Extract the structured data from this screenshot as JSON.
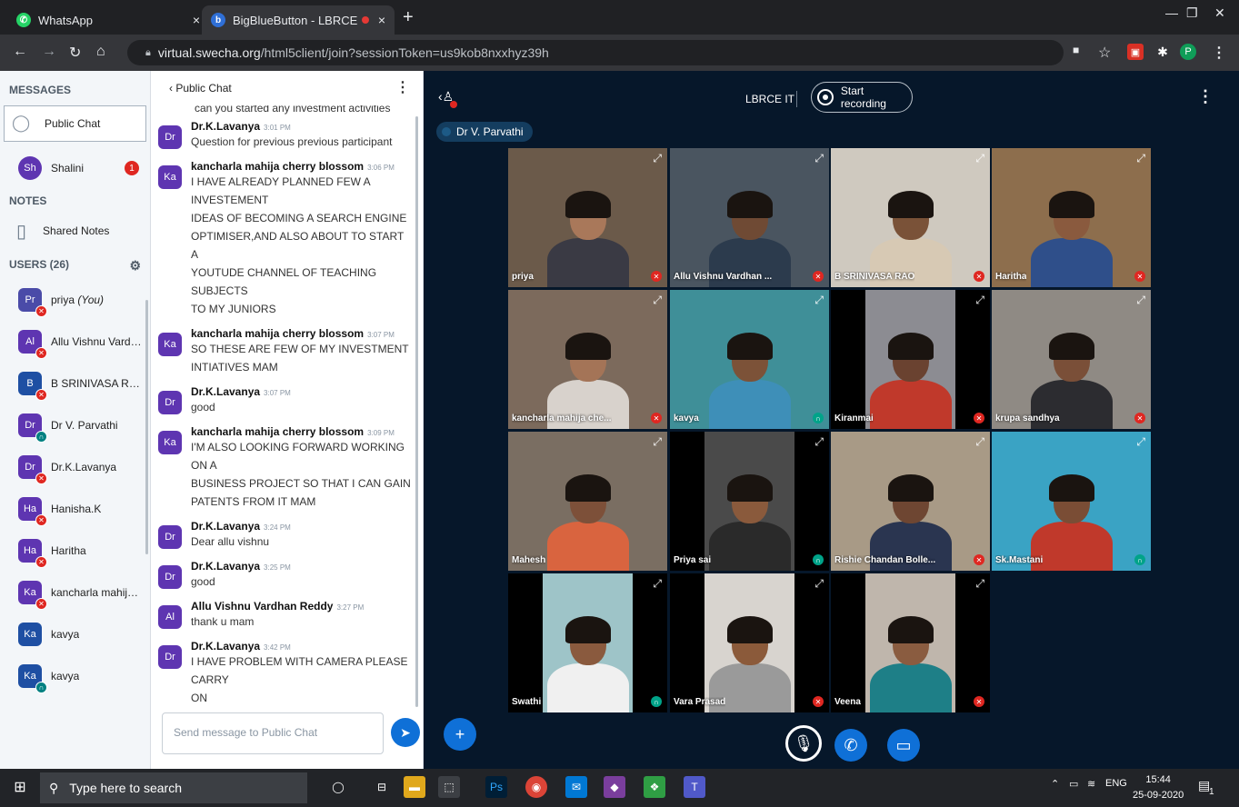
{
  "browser": {
    "tabs": [
      {
        "title": "WhatsApp",
        "close": "×"
      },
      {
        "title": "BigBlueButton - LBRCE IT",
        "close": "×"
      }
    ],
    "new_tab": "+",
    "url_host": "virtual.swecha.org",
    "url_path": "/html5client/join?sessionToken=us9kob8nxxhyz39h",
    "profile_letter": "P"
  },
  "left": {
    "messages_header": "MESSAGES",
    "public_chat": "Public Chat",
    "private_chat": {
      "initials": "Sh",
      "name": "Shalini",
      "unread": "1"
    },
    "notes_header": "NOTES",
    "shared_notes": "Shared Notes",
    "users_header": "USERS (26)",
    "users": [
      {
        "initials": "Pr",
        "name": "priya",
        "suffix": "(You)",
        "color": "#4a4ba8",
        "status": "muted"
      },
      {
        "initials": "Al",
        "name": "Allu Vishnu Vardha...",
        "suffix": "",
        "color": "#5e35b1",
        "status": "muted"
      },
      {
        "initials": "B",
        "name": "B SRINIVASA RAO",
        "suffix": "",
        "color": "#1e4fa3",
        "status": "muted"
      },
      {
        "initials": "Dr",
        "name": "Dr V. Parvathi",
        "suffix": "",
        "color": "#5e35b1",
        "status": "listen"
      },
      {
        "initials": "Dr",
        "name": "Dr.K.Lavanya",
        "suffix": "",
        "color": "#5e35b1",
        "status": "muted"
      },
      {
        "initials": "Ha",
        "name": "Hanisha.K",
        "suffix": "",
        "color": "#5e35b1",
        "status": "muted"
      },
      {
        "initials": "Ha",
        "name": "Haritha",
        "suffix": "",
        "color": "#5e35b1",
        "status": "muted"
      },
      {
        "initials": "Ka",
        "name": "kancharla mahija c...",
        "suffix": "",
        "color": "#5e35b1",
        "status": "muted"
      },
      {
        "initials": "Ka",
        "name": "kavya",
        "suffix": "",
        "color": "#1e4fa3",
        "status": "none"
      },
      {
        "initials": "Ka",
        "name": "kavya",
        "suffix": "",
        "color": "#1e4fa3",
        "status": "listen"
      }
    ]
  },
  "chat": {
    "back_label": "‹ Public Chat",
    "partial_line": "can you started any investment activities",
    "messages": [
      {
        "initials": "Dr",
        "name": "Dr.K.Lavanya",
        "time": "3:01 PM",
        "lines": [
          "Question for previous previous participant"
        ]
      },
      {
        "initials": "Ka",
        "name": "kancharla mahija cherry blossom",
        "time": "3:06 PM",
        "lines": [
          "I HAVE ALREADY PLANNED FEW A INVESTEMENT",
          "IDEAS OF BECOMING A SEARCH ENGINE",
          "OPTIMISER,AND ALSO ABOUT TO START A",
          "YOUTUDE CHANNEL OF TEACHING SUBJECTS",
          "TO MY JUNIORS"
        ]
      },
      {
        "initials": "Ka",
        "name": "kancharla mahija cherry blossom",
        "time": "3:07 PM",
        "lines": [
          "SO THESE ARE FEW OF MY INVESTMENT",
          "INTIATIVES MAM"
        ]
      },
      {
        "initials": "Dr",
        "name": "Dr.K.Lavanya",
        "time": "3:07 PM",
        "lines": [
          "good"
        ]
      },
      {
        "initials": "Ka",
        "name": "kancharla mahija cherry blossom",
        "time": "3:09 PM",
        "lines": [
          "I'M ALSO LOOKING FORWARD WORKING ON A",
          "BUSINESS PROJECT SO THAT I CAN GAIN",
          "PATENTS FROM IT MAM"
        ]
      },
      {
        "initials": "Dr",
        "name": "Dr.K.Lavanya",
        "time": "3:24 PM",
        "lines": [
          "Dear allu vishnu"
        ]
      },
      {
        "initials": "Dr",
        "name": "Dr.K.Lavanya",
        "time": "3:25 PM",
        "lines": [
          "good"
        ]
      },
      {
        "initials": "Al",
        "name": "Allu Vishnu Vardhan Reddy",
        "time": "3:27 PM",
        "lines": [
          "thank u mam"
        ]
      },
      {
        "initials": "Dr",
        "name": "Dr.K.Lavanya",
        "time": "3:42 PM",
        "lines": [
          "I HAVE PROBLEM WITH CAMERA PLEASE CARRY",
          "ON"
        ]
      }
    ],
    "input_placeholder": "Send message to Public Chat"
  },
  "main": {
    "room_name": "LBRCE IT",
    "record_label": "Start recording",
    "speaker": "Dr V. Parvathi",
    "tiles": [
      {
        "name": "priya",
        "mic": "muted",
        "bg": "#6b5a4a",
        "skin": "#a9785a",
        "shirt": "#3a3a44"
      },
      {
        "name": "Allu Vishnu Vardhan ...",
        "mic": "muted",
        "bg": "#4a5560",
        "skin": "#6f4a34",
        "shirt": "#2c3b4d"
      },
      {
        "name": "B SRINIVASA RAO",
        "mic": "muted",
        "bg": "#cfc9bf",
        "skin": "#7a5238",
        "shirt": "#d7c9b4"
      },
      {
        "name": "Haritha",
        "mic": "muted",
        "bg": "#8d6e4d",
        "skin": "#8a5a3e",
        "shirt": "#2f4f8a"
      },
      {
        "name": "kancharla mahija che...",
        "mic": "muted",
        "bg": "#7c6a5c",
        "skin": "#a47457",
        "shirt": "#d8d2cc"
      },
      {
        "name": "kavya",
        "mic": "listen",
        "bg": "#3f8f98",
        "skin": "#7c5238",
        "shirt": "#3e8fb8"
      },
      {
        "name": "Kiranmai",
        "mic": "muted",
        "bg": "#8c8c92",
        "skin": "#6a4230",
        "shirt": "#c0392b"
      },
      {
        "name": "krupa sandhya",
        "mic": "muted",
        "bg": "#8f8a84",
        "skin": "#7a4f38",
        "shirt": "#2c2c30"
      },
      {
        "name": "Mahesh",
        "mic": "none",
        "bg": "#7a6e62",
        "skin": "#7d5039",
        "shirt": "#d9643f"
      },
      {
        "name": "Priya sai",
        "mic": "listen",
        "bg": "#4a4a4a",
        "skin": "#8a5a3c",
        "shirt": "#2a2a2a"
      },
      {
        "name": "Rishie Chandan Bolle...",
        "mic": "muted",
        "bg": "#a89a86",
        "skin": "#6e4632",
        "shirt": "#2a3550"
      },
      {
        "name": "Sk.Mastani",
        "mic": "listen",
        "bg": "#3aa3c4",
        "skin": "#7a4d35",
        "shirt": "#c0392b"
      },
      {
        "name": "Swathi",
        "mic": "listen",
        "bg": "#9ec4c8",
        "skin": "#8a5a3e",
        "shirt": "#f0f0f0"
      },
      {
        "name": "Vara Prasad",
        "mic": "muted",
        "bg": "#d8d4cf",
        "skin": "#8b5a3a",
        "shirt": "#9a9a9a"
      },
      {
        "name": "Veena",
        "mic": "muted",
        "bg": "#bfb6ac",
        "skin": "#8a5c40",
        "shirt": "#1e7f87"
      }
    ]
  },
  "taskbar": {
    "search_placeholder": "Type here to search",
    "lang": "ENG",
    "time": "15:44",
    "date": "25-09-2020",
    "notif_count": "1"
  }
}
